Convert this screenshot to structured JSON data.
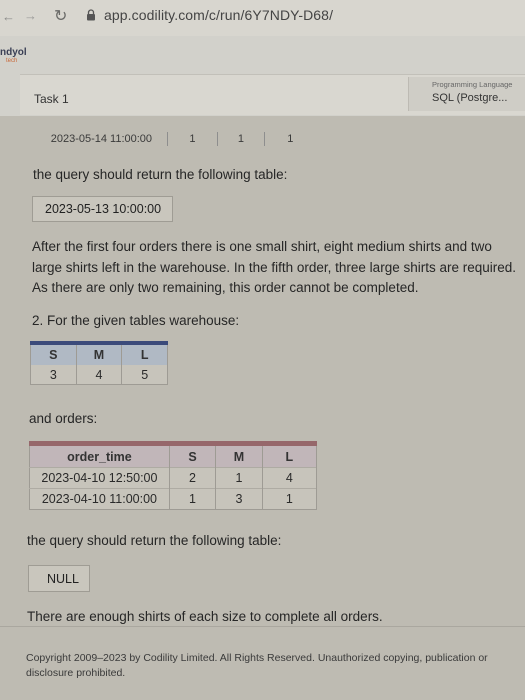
{
  "browser": {
    "nav_back": "←",
    "nav_forward": "→",
    "url": "app.codility.com/c/run/6Y7NDY-D68/"
  },
  "header": {
    "brand_name": "ndyol",
    "brand_sub": "tech",
    "task_title": "Task 1",
    "language_caption": "Programming Language",
    "language_value": "SQL (Postgre..."
  },
  "content": {
    "fragment_row": [
      "2023-05-14 11:00:00",
      "1",
      "1",
      "1"
    ],
    "query_return_1": "the query should return the following table:",
    "result_1": "2023-05-13 10:00:00",
    "explanation_1": "After the first four orders there is one small shirt, eight medium shirts and two large shirts left in the warehouse. In the fifth order, three large shirts are required. As there are only two remaining, this order cannot be completed.",
    "example_2_intro": "2. For the given tables warehouse:",
    "warehouse": {
      "headers": [
        "S",
        "M",
        "L"
      ],
      "rows": [
        [
          "3",
          "4",
          "5"
        ]
      ]
    },
    "and_orders": "and orders:",
    "orders": {
      "headers": [
        "order_time",
        "S",
        "M",
        "L"
      ],
      "rows": [
        [
          "2023-04-10 12:50:00",
          "2",
          "1",
          "4"
        ],
        [
          "2023-04-10 11:00:00",
          "1",
          "3",
          "1"
        ]
      ]
    },
    "query_return_2": "the query should return the following table:",
    "result_2": "NULL",
    "explanation_2": "There are enough shirts of each size to complete all orders.",
    "copyright": "Copyright 2009–2023 by Codility Limited. All Rights Reserved. Unauthorized copying, publication or disclosure prohibited."
  },
  "colors": {
    "warehouse_header_bar": "#3b4a7a",
    "orders_header_bar": "#96676b"
  }
}
